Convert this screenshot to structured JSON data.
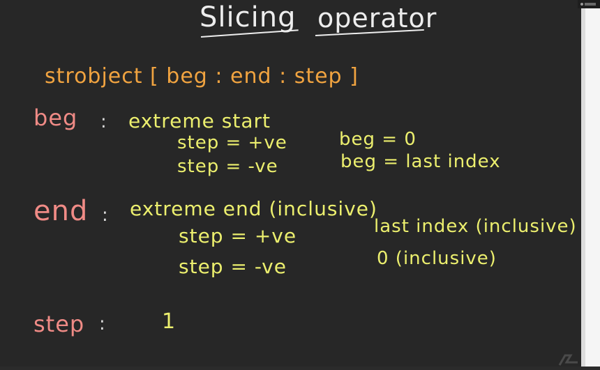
{
  "board": {
    "title_word_1": "Slicing",
    "title_word_2": "operator",
    "syntax": "strobject [ beg : end : step ]",
    "beg": {
      "label": "beg",
      "colon": ":",
      "description": "extreme start",
      "rows": [
        {
          "step": "step = +ve",
          "value": "beg = 0"
        },
        {
          "step": "step = -ve",
          "value": "beg = last index"
        }
      ]
    },
    "end": {
      "label": "end",
      "colon": ":",
      "description": "extreme end (inclusive)",
      "rows": [
        {
          "step": "step = +ve",
          "value": "last index (inclusive)"
        },
        {
          "step": "step = -ve",
          "value": "0 (inclusive)"
        }
      ]
    },
    "step": {
      "label": "step",
      "colon": ":",
      "value": "1"
    }
  },
  "colors": {
    "background": "#272727",
    "title": "#ededed",
    "syntax": "#f0a340",
    "labels": "#f08b86",
    "notes": "#ecef6e"
  }
}
